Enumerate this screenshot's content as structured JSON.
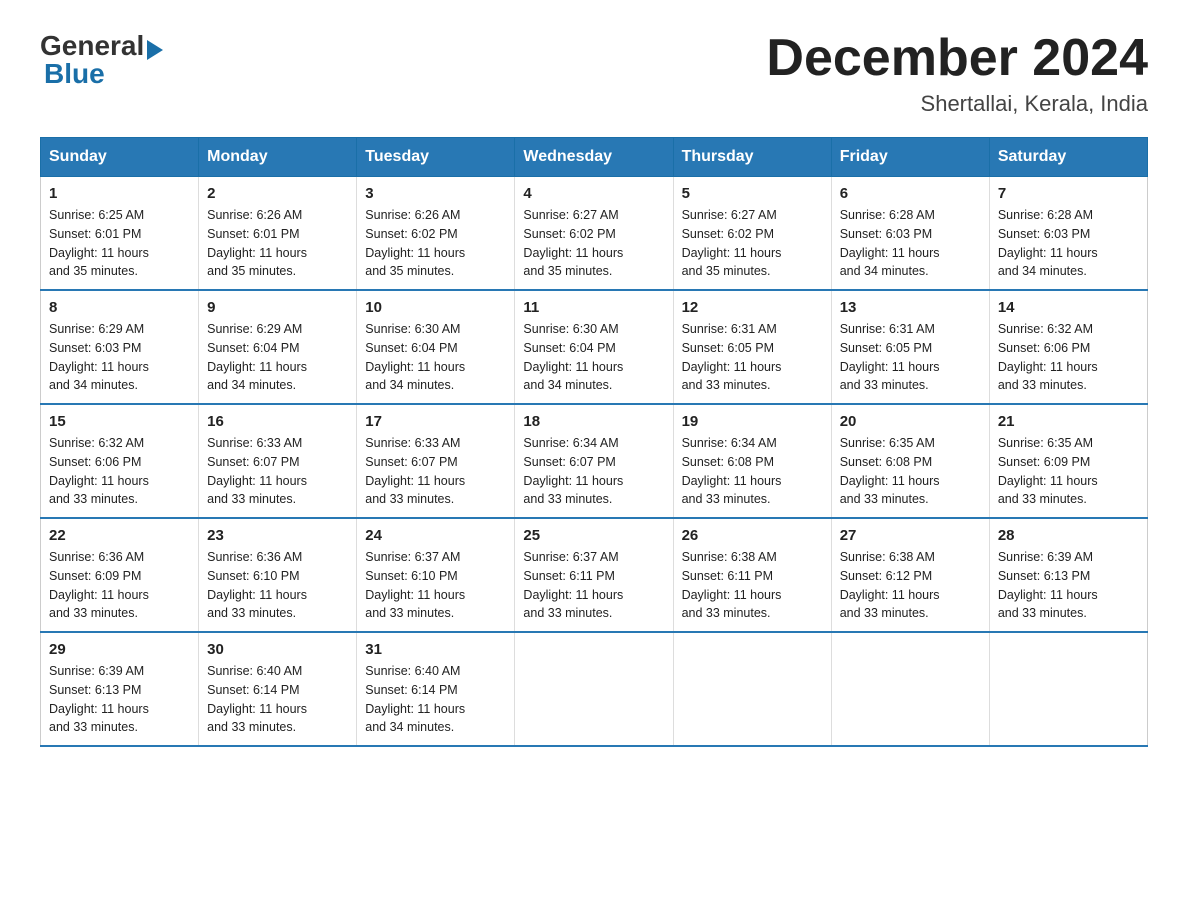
{
  "logo": {
    "general": "General",
    "arrow": "▶",
    "blue": "Blue"
  },
  "header": {
    "title": "December 2024",
    "subtitle": "Shertallai, Kerala, India"
  },
  "days_of_week": [
    "Sunday",
    "Monday",
    "Tuesday",
    "Wednesday",
    "Thursday",
    "Friday",
    "Saturday"
  ],
  "weeks": [
    [
      {
        "num": "1",
        "sunrise": "6:25 AM",
        "sunset": "6:01 PM",
        "daylight": "11 hours and 35 minutes."
      },
      {
        "num": "2",
        "sunrise": "6:26 AM",
        "sunset": "6:01 PM",
        "daylight": "11 hours and 35 minutes."
      },
      {
        "num": "3",
        "sunrise": "6:26 AM",
        "sunset": "6:02 PM",
        "daylight": "11 hours and 35 minutes."
      },
      {
        "num": "4",
        "sunrise": "6:27 AM",
        "sunset": "6:02 PM",
        "daylight": "11 hours and 35 minutes."
      },
      {
        "num": "5",
        "sunrise": "6:27 AM",
        "sunset": "6:02 PM",
        "daylight": "11 hours and 35 minutes."
      },
      {
        "num": "6",
        "sunrise": "6:28 AM",
        "sunset": "6:03 PM",
        "daylight": "11 hours and 34 minutes."
      },
      {
        "num": "7",
        "sunrise": "6:28 AM",
        "sunset": "6:03 PM",
        "daylight": "11 hours and 34 minutes."
      }
    ],
    [
      {
        "num": "8",
        "sunrise": "6:29 AM",
        "sunset": "6:03 PM",
        "daylight": "11 hours and 34 minutes."
      },
      {
        "num": "9",
        "sunrise": "6:29 AM",
        "sunset": "6:04 PM",
        "daylight": "11 hours and 34 minutes."
      },
      {
        "num": "10",
        "sunrise": "6:30 AM",
        "sunset": "6:04 PM",
        "daylight": "11 hours and 34 minutes."
      },
      {
        "num": "11",
        "sunrise": "6:30 AM",
        "sunset": "6:04 PM",
        "daylight": "11 hours and 34 minutes."
      },
      {
        "num": "12",
        "sunrise": "6:31 AM",
        "sunset": "6:05 PM",
        "daylight": "11 hours and 33 minutes."
      },
      {
        "num": "13",
        "sunrise": "6:31 AM",
        "sunset": "6:05 PM",
        "daylight": "11 hours and 33 minutes."
      },
      {
        "num": "14",
        "sunrise": "6:32 AM",
        "sunset": "6:06 PM",
        "daylight": "11 hours and 33 minutes."
      }
    ],
    [
      {
        "num": "15",
        "sunrise": "6:32 AM",
        "sunset": "6:06 PM",
        "daylight": "11 hours and 33 minutes."
      },
      {
        "num": "16",
        "sunrise": "6:33 AM",
        "sunset": "6:07 PM",
        "daylight": "11 hours and 33 minutes."
      },
      {
        "num": "17",
        "sunrise": "6:33 AM",
        "sunset": "6:07 PM",
        "daylight": "11 hours and 33 minutes."
      },
      {
        "num": "18",
        "sunrise": "6:34 AM",
        "sunset": "6:07 PM",
        "daylight": "11 hours and 33 minutes."
      },
      {
        "num": "19",
        "sunrise": "6:34 AM",
        "sunset": "6:08 PM",
        "daylight": "11 hours and 33 minutes."
      },
      {
        "num": "20",
        "sunrise": "6:35 AM",
        "sunset": "6:08 PM",
        "daylight": "11 hours and 33 minutes."
      },
      {
        "num": "21",
        "sunrise": "6:35 AM",
        "sunset": "6:09 PM",
        "daylight": "11 hours and 33 minutes."
      }
    ],
    [
      {
        "num": "22",
        "sunrise": "6:36 AM",
        "sunset": "6:09 PM",
        "daylight": "11 hours and 33 minutes."
      },
      {
        "num": "23",
        "sunrise": "6:36 AM",
        "sunset": "6:10 PM",
        "daylight": "11 hours and 33 minutes."
      },
      {
        "num": "24",
        "sunrise": "6:37 AM",
        "sunset": "6:10 PM",
        "daylight": "11 hours and 33 minutes."
      },
      {
        "num": "25",
        "sunrise": "6:37 AM",
        "sunset": "6:11 PM",
        "daylight": "11 hours and 33 minutes."
      },
      {
        "num": "26",
        "sunrise": "6:38 AM",
        "sunset": "6:11 PM",
        "daylight": "11 hours and 33 minutes."
      },
      {
        "num": "27",
        "sunrise": "6:38 AM",
        "sunset": "6:12 PM",
        "daylight": "11 hours and 33 minutes."
      },
      {
        "num": "28",
        "sunrise": "6:39 AM",
        "sunset": "6:13 PM",
        "daylight": "11 hours and 33 minutes."
      }
    ],
    [
      {
        "num": "29",
        "sunrise": "6:39 AM",
        "sunset": "6:13 PM",
        "daylight": "11 hours and 33 minutes."
      },
      {
        "num": "30",
        "sunrise": "6:40 AM",
        "sunset": "6:14 PM",
        "daylight": "11 hours and 33 minutes."
      },
      {
        "num": "31",
        "sunrise": "6:40 AM",
        "sunset": "6:14 PM",
        "daylight": "11 hours and 34 minutes."
      },
      null,
      null,
      null,
      null
    ]
  ],
  "labels": {
    "sunrise": "Sunrise:",
    "sunset": "Sunset:",
    "daylight": "Daylight:"
  }
}
